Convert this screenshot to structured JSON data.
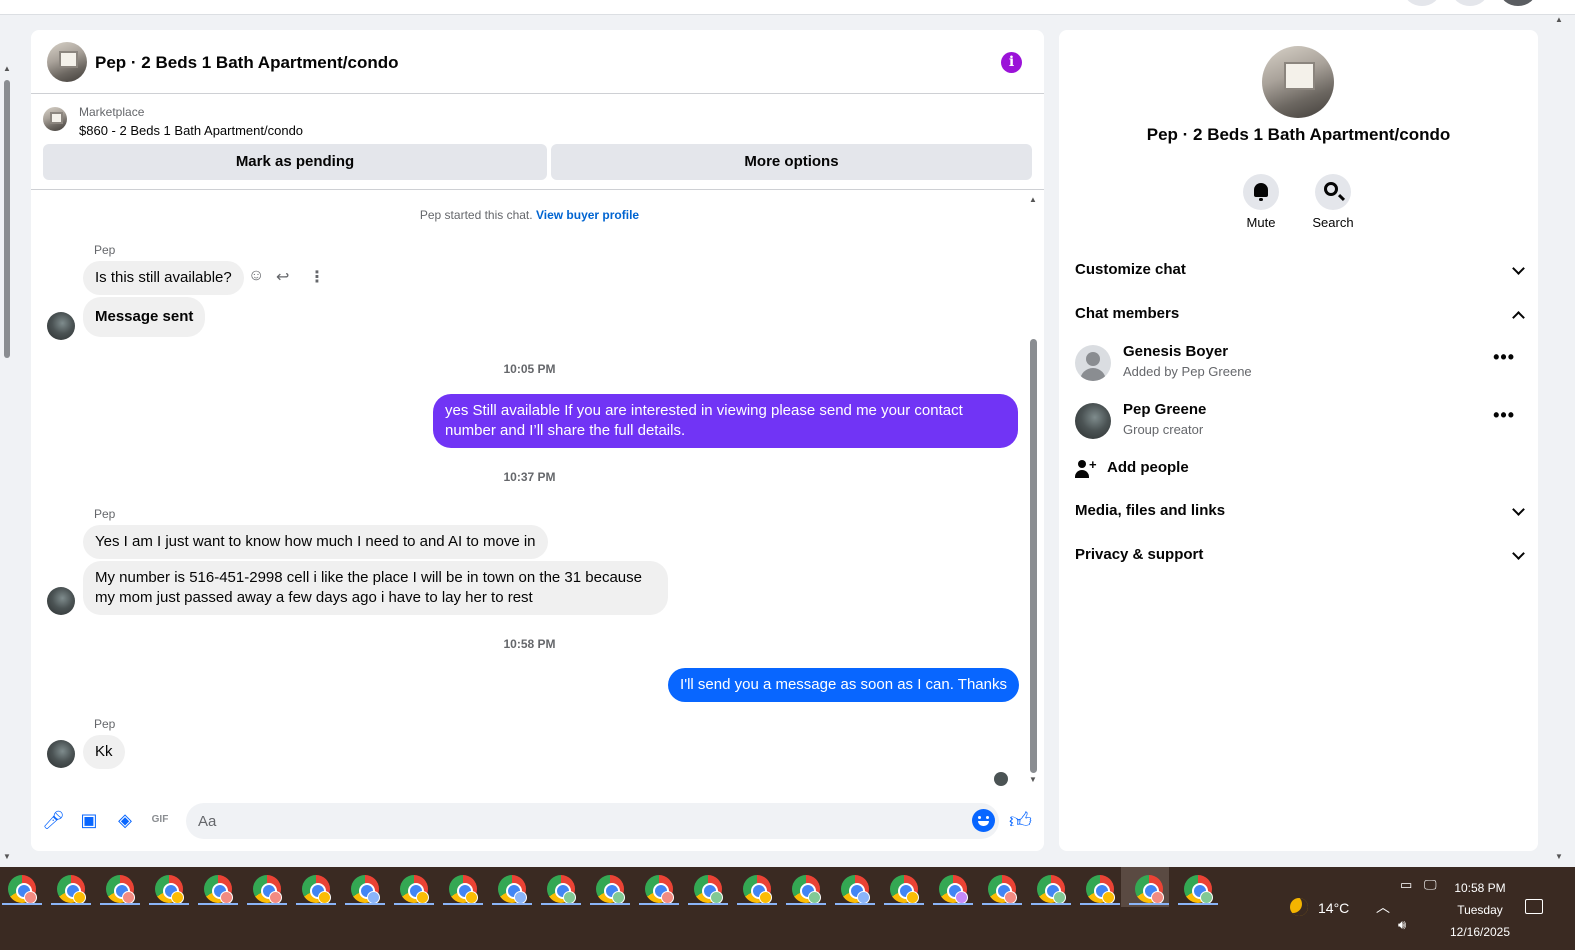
{
  "chat": {
    "title": "Pep · 2 Beds 1 Bath Apartment/condo",
    "marketplace": {
      "label": "Marketplace",
      "listing": "$860 - 2 Beds 1 Bath Apartment/condo",
      "mark_pending": "Mark as pending",
      "more_options": "More options"
    },
    "started_text": "Pep started this chat.",
    "view_buyer_profile": "View buyer profile",
    "messages": [
      {
        "sender": "Pep",
        "text": "Is this still available?"
      },
      {
        "text": "Message sent"
      },
      {
        "time": "10:05 PM"
      },
      {
        "text": "yes Still available If you are interested in viewing please send me your contact number and I’ll share the full details."
      },
      {
        "time": "10:37 PM"
      },
      {
        "sender": "Pep",
        "text": "Yes I am I just want to know how much I need to and AI to move in"
      },
      {
        "text": "My number is 516-451-2998 cell i like the place I will be in town on the 31 because my mom just passed away a few days ago i have to lay her to rest"
      },
      {
        "time": "10:58 PM"
      },
      {
        "text": "I'll send you a message as soon as I can. Thanks"
      },
      {
        "sender": "Pep",
        "text": "Kk"
      }
    ],
    "composer_placeholder": "Aa"
  },
  "info_panel": {
    "title": "Pep · 2 Beds 1 Bath Apartment/condo",
    "mute": "Mute",
    "search": "Search",
    "customize_chat": "Customize chat",
    "chat_members": "Chat members",
    "members": [
      {
        "name": "Genesis Boyer",
        "sub": "Added by Pep Greene"
      },
      {
        "name": "Pep Greene",
        "sub": "Group creator"
      }
    ],
    "add_people": "Add people",
    "media_files_links": "Media, files and links",
    "privacy_support": "Privacy & support"
  },
  "taskbar": {
    "weather": "14°C",
    "time": "10:58 PM",
    "day": "Tuesday",
    "date": "12/16/2025"
  },
  "colors": {
    "outgoing_purple": "#7134f5",
    "outgoing_blue": "#0866ff",
    "info_icon": "#9b12d8",
    "link": "#0064d1"
  }
}
